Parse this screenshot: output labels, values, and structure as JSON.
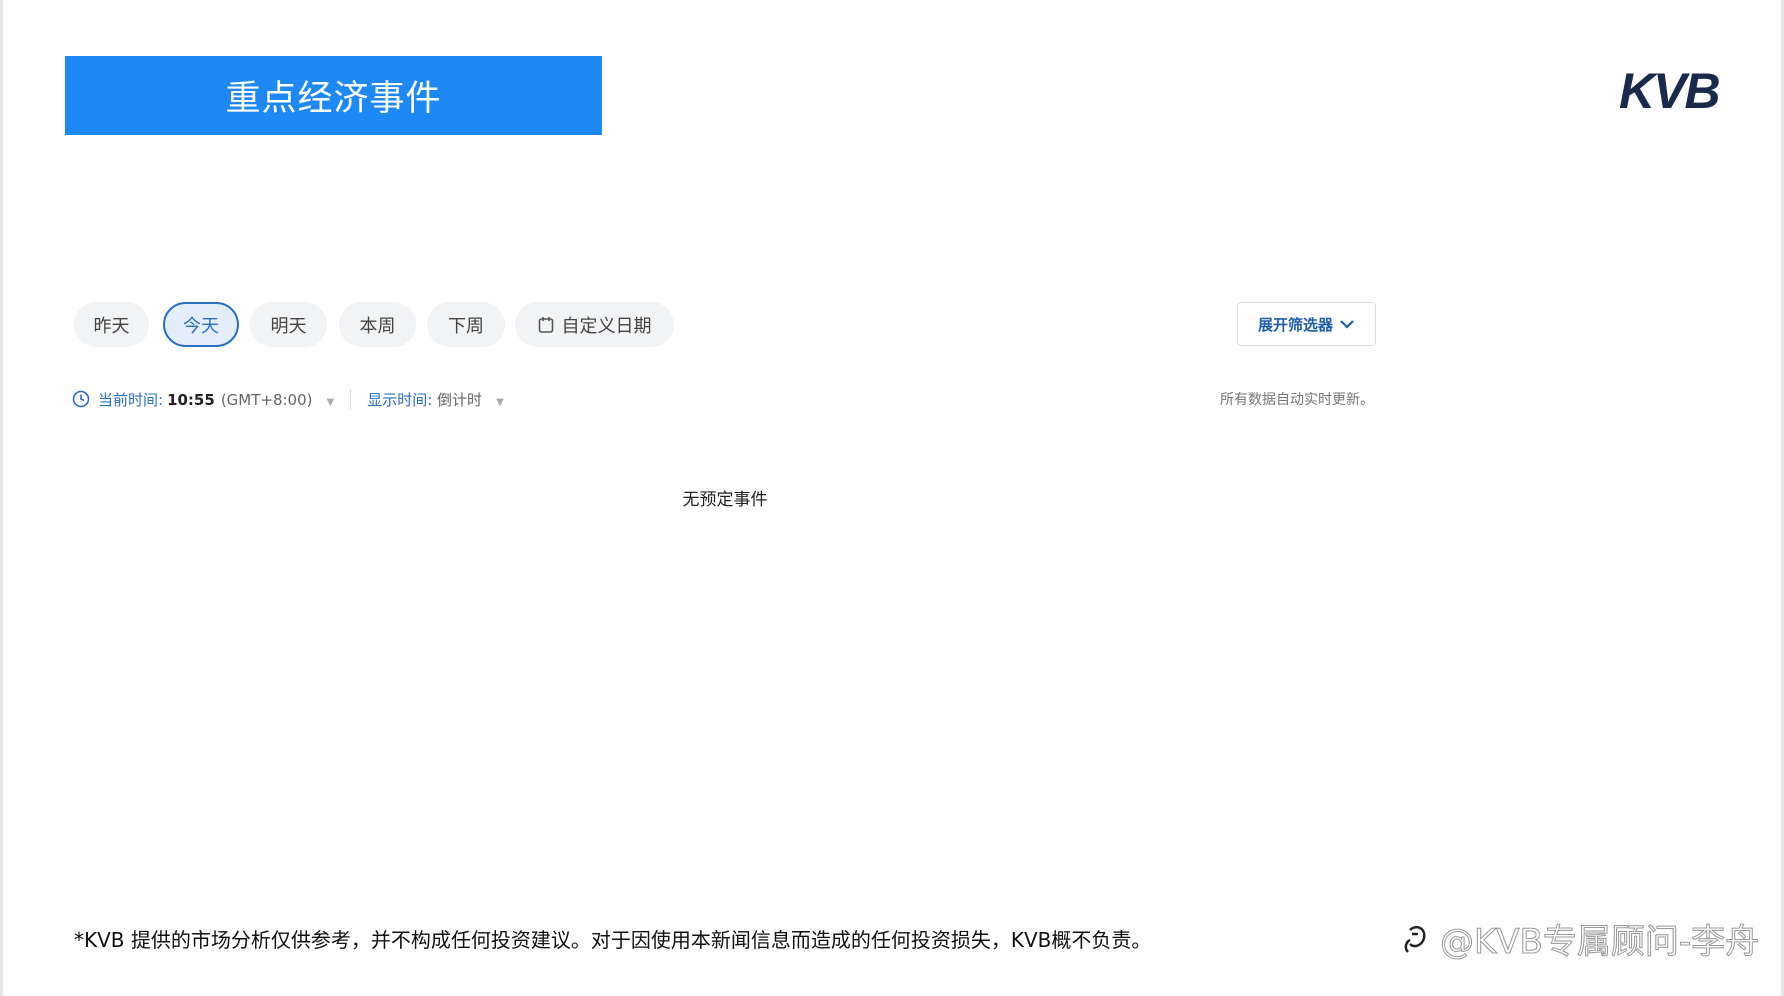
{
  "header": {
    "title": "重点经济事件",
    "logo": "KVB"
  },
  "date_tabs": [
    {
      "label": "昨天"
    },
    {
      "label": "今天",
      "active": true
    },
    {
      "label": "明天"
    },
    {
      "label": "本周"
    },
    {
      "label": "下周"
    },
    {
      "label": "自定义日期",
      "icon": "calendar-icon"
    }
  ],
  "filter_button": {
    "label": "展开筛选器",
    "icon": "chevron-down-icon"
  },
  "time_bar": {
    "current_label": "当前时间:",
    "current_time": "10:55",
    "timezone": "(GMT+8:00)",
    "display_label": "显示时间:",
    "display_value": "倒计时",
    "auto_update": "所有数据自动实时更新。"
  },
  "empty_message": "无预定事件",
  "disclaimer": "*KVB 提供的市场分析仅供参考，并不构成任何投资建议。对于因使用本新闻信息而造成的任何投资损失，KVB概不负责。",
  "watermark": "@KVB专属顾问-李舟",
  "colors": {
    "accent": "#1e88f5",
    "active_tab": "#2a6fc0"
  }
}
